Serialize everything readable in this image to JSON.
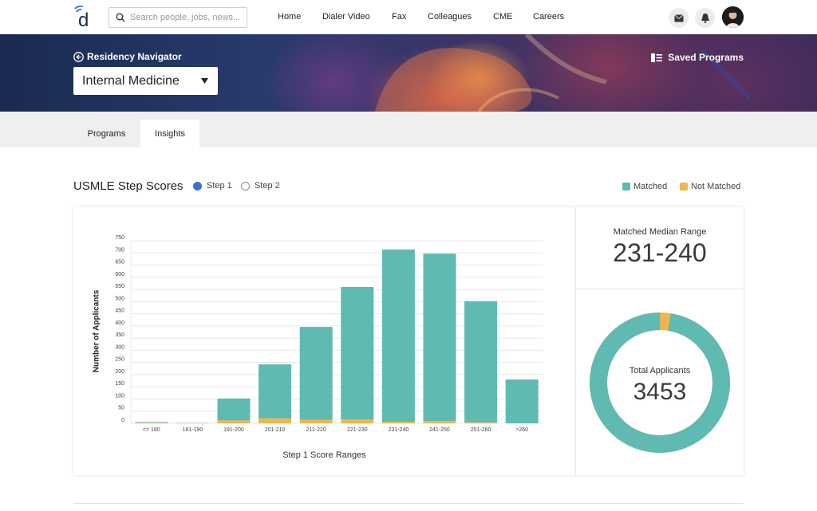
{
  "nav": {
    "search_placeholder": "Search people, jobs, news...",
    "links": [
      "Home",
      "Dialer Video",
      "Fax",
      "Colleagues",
      "CME",
      "Careers"
    ]
  },
  "hero": {
    "back_label": "Residency Navigator",
    "specialty": "Internal Medicine",
    "saved_label": "Saved Programs"
  },
  "tabs": [
    "Programs",
    "Insights"
  ],
  "active_tab": "Insights",
  "section": {
    "title": "USMLE Step Scores",
    "options": [
      "Step 1",
      "Step 2"
    ],
    "selected": "Step 1",
    "legend": [
      {
        "label": "Matched",
        "color": "#5fbab1"
      },
      {
        "label": "Not Matched",
        "color": "#f0b54e"
      }
    ]
  },
  "stats": {
    "median_label": "Matched Median Range",
    "median_value": "231-240",
    "total_label": "Total Applicants",
    "total_value": "3453"
  },
  "chart_data": {
    "type": "bar",
    "stacked": true,
    "xlabel": "Step 1 Score Ranges",
    "ylabel": "Number of Applicants",
    "ylim": [
      0,
      750
    ],
    "yticks": [
      0,
      50,
      100,
      150,
      200,
      250,
      300,
      350,
      400,
      450,
      500,
      550,
      600,
      650,
      700,
      750
    ],
    "grid": true,
    "categories": [
      "<= 180",
      "181-190",
      "191-200",
      "201-210",
      "211-220",
      "221-230",
      "231-240",
      "241-250",
      "251-260",
      ">260"
    ],
    "series": [
      {
        "name": "Not Matched",
        "color": "#f0b54e",
        "values": [
          2,
          1,
          12,
          20,
          14,
          16,
          6,
          9,
          4,
          0
        ]
      },
      {
        "name": "Matched",
        "color": "#5fbab1",
        "values": [
          3,
          1,
          90,
          222,
          382,
          544,
          708,
          688,
          498,
          180
        ]
      }
    ]
  },
  "donut": {
    "matched_fraction": 0.975,
    "colors": {
      "matched": "#5fbab1",
      "not_matched": "#f0b54e"
    }
  }
}
